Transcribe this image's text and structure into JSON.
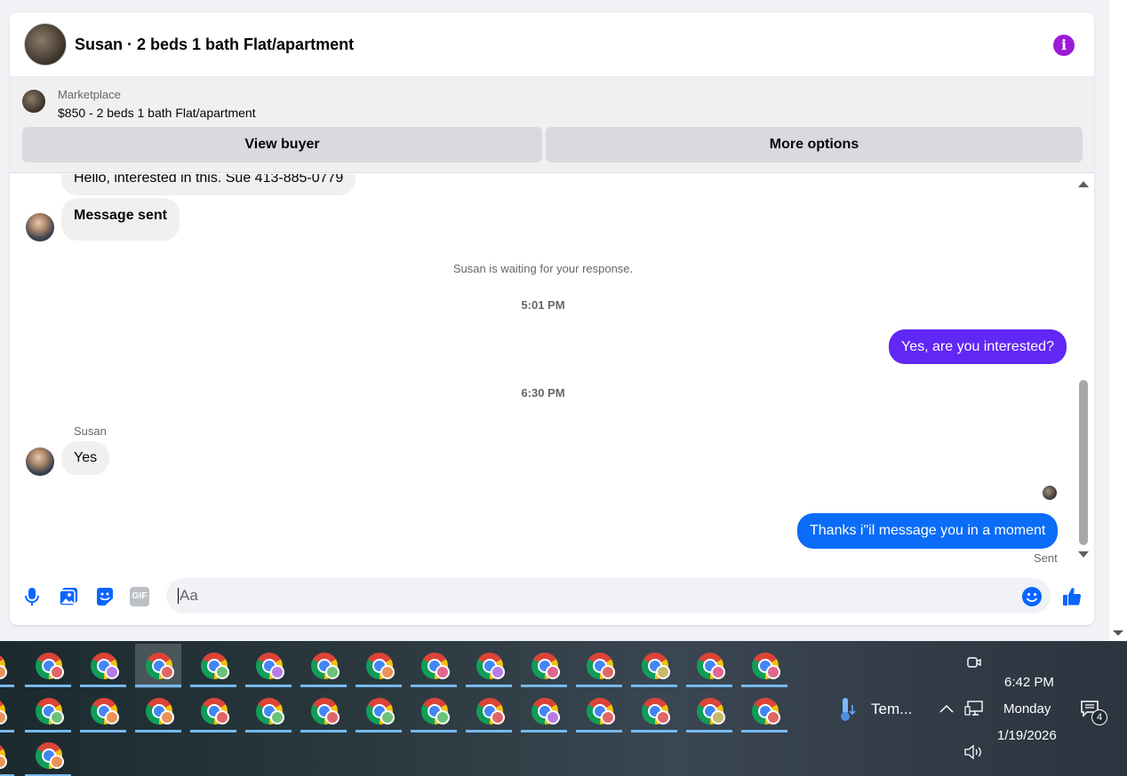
{
  "conversation": {
    "title": "Susan · 2 beds 1 bath Flat/apartment",
    "info_icon": "i"
  },
  "listing": {
    "source": "Marketplace",
    "price_title": "$850 - 2 beds 1 bath Flat/apartment",
    "view_buyer_label": "View buyer",
    "more_options_label": "More options"
  },
  "messages": {
    "first_incoming": "Hello, interested in this. Sue 413-885-0779",
    "message_sent": "Message sent",
    "waiting_notice": "Susan is waiting for your response.",
    "time_1": "5:01 PM",
    "outgoing_1": "Yes, are you interested?",
    "time_2": "6:30 PM",
    "sender_name": "Susan",
    "incoming_2": "Yes",
    "outgoing_2": "Thanks i\"il message you in a moment",
    "status": "Sent"
  },
  "composer": {
    "placeholder": "Aa",
    "icons": [
      "microphone-icon",
      "image-icon",
      "sticker-icon",
      "gif-icon",
      "emoji-icon",
      "thumbs-up-icon"
    ],
    "gif_label": "GIF"
  },
  "taskbar": {
    "row1_badges": [
      "#e06666",
      "#b57ce6",
      "#e06666",
      "#6cc27a",
      "#b57ce6",
      "#6cc27a",
      "#e8935a",
      "#e06690",
      "#b57ce6",
      "#e06690",
      "#e06666",
      "#c9b86a",
      "#e06690",
      "#e06690"
    ],
    "row2_badges": [
      "#6cc27a",
      "#e8935a",
      "#e8935a",
      "#e06666",
      "#6cc27a",
      "#e06666",
      "#6cc27a",
      "#6cc27a",
      "#e06666",
      "#b57ce6",
      "#e06666",
      "#e06666",
      "#c9b86a",
      "#e06666"
    ],
    "row3_badges": [
      "#e8935a"
    ],
    "weather_label": "Tem...",
    "time": "6:42 PM",
    "day": "Monday",
    "date": "1/19/2026",
    "notification_count": "4"
  }
}
